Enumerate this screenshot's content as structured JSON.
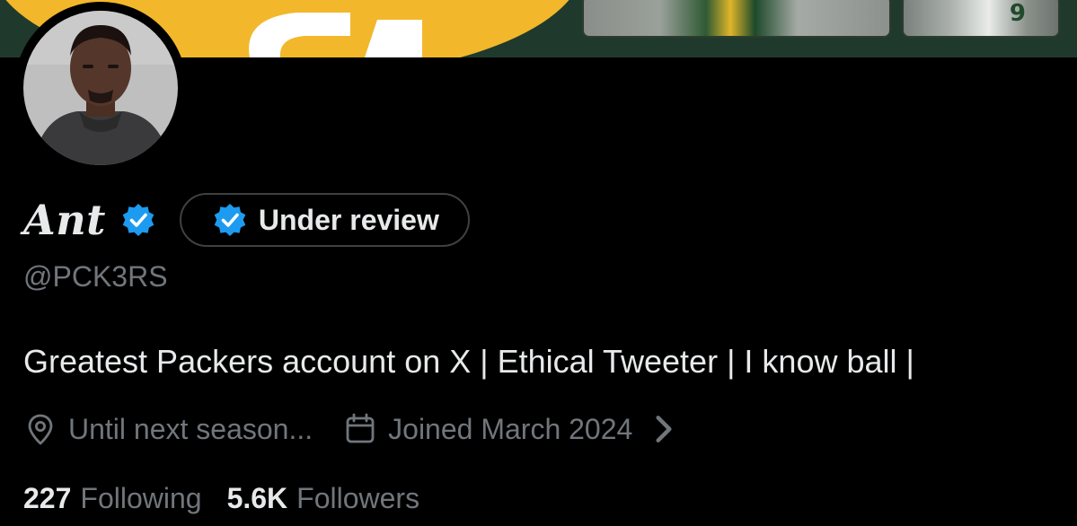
{
  "banner": {
    "jersey_number": "9"
  },
  "profile": {
    "display_name": "Ant",
    "verification_pill": "Under review",
    "handle": "@PCK3RS",
    "bio": "Greatest Packers account on X | Ethical Tweeter | I know ball |",
    "location": "Until next season...",
    "joined": "Joined March 2024"
  },
  "stats": {
    "following_count": "227",
    "following_label": "Following",
    "followers_count": "5.6K",
    "followers_label": "Followers"
  },
  "icons": {
    "verified": "verified-badge-icon",
    "location": "location-pin-icon",
    "calendar": "calendar-icon",
    "chevron": "chevron-right-icon"
  },
  "colors": {
    "background": "#000000",
    "text_primary": "#e7e9ea",
    "text_secondary": "#71767b",
    "verified_blue": "#1d9bf0",
    "banner_green": "#1f3a2c",
    "banner_gold": "#f2b72b"
  }
}
